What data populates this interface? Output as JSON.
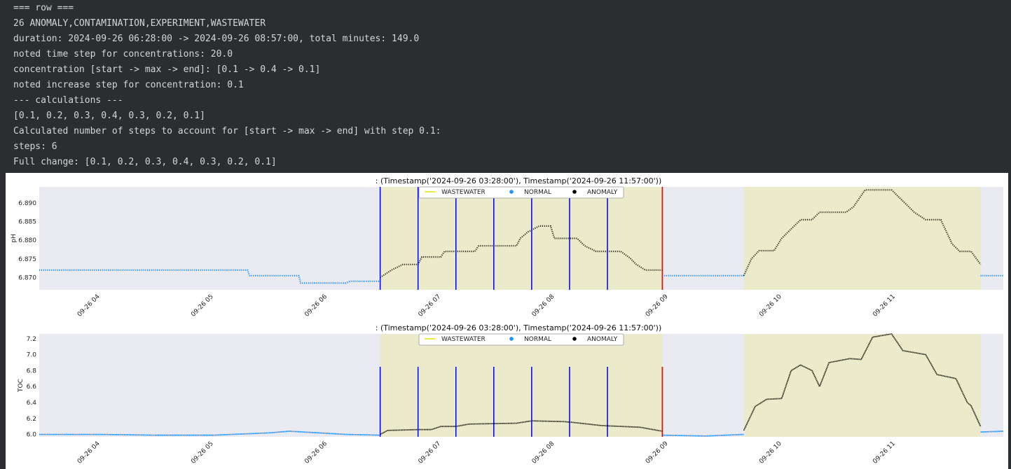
{
  "console": {
    "lines": [
      "=== row ===",
      "26 ANOMALY,CONTAMINATION,EXPERIMENT,WASTEWATER",
      "duration: 2024-09-26 06:28:00 -> 2024-09-26 08:57:00, total minutes: 149.0",
      "noted time step for concentrations: 20.0",
      "concentration [start -> max -> end]: [0.1 -> 0.4 -> 0.1]",
      "noted increase step for concentration: 0.1",
      "--- calculations ---",
      "[0.1, 0.2, 0.3, 0.4, 0.3, 0.2, 0.1]",
      "Calculated number of steps to account for [start -> max -> end] with step 0.1:",
      "steps: 6",
      "Full change: [0.1, 0.2, 0.3, 0.4, 0.3, 0.2, 0.1]"
    ]
  },
  "colors": {
    "background": "#2b2d30",
    "console_text": "#d4d6da",
    "plot_bg": "#eaeaf2",
    "wastewater_band": "#ebebcb",
    "normal": "#1e90ff",
    "anomaly": "#000000",
    "wastewater_legend": "#e6e600",
    "step_line": "#0000cc",
    "end_line": "#dd1111"
  },
  "chart_data": [
    {
      "type": "scatter",
      "title": ": (Timestamp('2024-09-26 03:28:00'), Timestamp('2024-09-26 11:57:00'))",
      "xlabel": "",
      "ylabel": "pH",
      "xlim": [
        "2024-09-26 03:28",
        "2024-09-26 11:57"
      ],
      "ylim": [
        6.8667,
        6.8943
      ],
      "x_ticks": [
        "09-26 04",
        "09-26 05",
        "09-26 06",
        "09-26 07",
        "09-26 08",
        "09-26 09",
        "09-26 10",
        "09-26 11"
      ],
      "y_ticks": [
        "6.870",
        "6.875",
        "6.880",
        "6.885",
        "6.890"
      ],
      "legend": [
        "WASTEWATER",
        "NORMAL",
        "ANOMALY"
      ],
      "legend_position": "top-center",
      "grid": false,
      "wastewater_spans": [
        [
          "2024-09-26 06:28",
          "2024-09-26 08:57"
        ],
        [
          "2024-09-26 09:40",
          "2024-09-26 11:45"
        ]
      ],
      "step_lines": [
        "2024-09-26 06:28",
        "2024-09-26 06:48",
        "2024-09-26 07:08",
        "2024-09-26 07:28",
        "2024-09-26 07:48",
        "2024-09-26 08:08",
        "2024-09-26 08:28"
      ],
      "end_line": "2024-09-26 08:57",
      "series": [
        {
          "name": "NORMAL",
          "points": [
            [
              "2024-09-26 03:28",
              6.872
            ],
            [
              "2024-09-26 04:00",
              6.872
            ],
            [
              "2024-09-26 04:30",
              6.872
            ],
            [
              "2024-09-26 05:00",
              6.872
            ],
            [
              "2024-09-26 05:18",
              6.872
            ],
            [
              "2024-09-26 05:19",
              6.8705
            ],
            [
              "2024-09-26 05:45",
              6.8705
            ],
            [
              "2024-09-26 05:46",
              6.8685
            ],
            [
              "2024-09-26 06:10",
              6.8685
            ],
            [
              "2024-09-26 06:12",
              6.869
            ],
            [
              "2024-09-26 06:28",
              6.869
            ]
          ]
        },
        {
          "name": "NORMAL",
          "points": [
            [
              "2024-09-26 08:58",
              6.8705
            ],
            [
              "2024-09-26 09:40",
              6.8705
            ]
          ]
        },
        {
          "name": "NORMAL",
          "points": [
            [
              "2024-09-26 11:45",
              6.8705
            ],
            [
              "2024-09-26 11:57",
              6.8705
            ]
          ]
        },
        {
          "name": "ANOMALY",
          "points": [
            [
              "2024-09-26 06:28",
              6.87
            ],
            [
              "2024-09-26 06:34",
              6.872
            ],
            [
              "2024-09-26 06:40",
              6.8735
            ],
            [
              "2024-09-26 06:48",
              6.8735
            ],
            [
              "2024-09-26 06:50",
              6.8755
            ],
            [
              "2024-09-26 07:00",
              6.8755
            ],
            [
              "2024-09-26 07:02",
              6.877
            ],
            [
              "2024-09-26 07:18",
              6.877
            ],
            [
              "2024-09-26 07:20",
              6.8785
            ],
            [
              "2024-09-26 07:28",
              6.8785
            ],
            [
              "2024-09-26 07:40",
              6.8785
            ],
            [
              "2024-09-26 07:42",
              6.8805
            ],
            [
              "2024-09-26 07:46",
              6.8822
            ],
            [
              "2024-09-26 07:52",
              6.8838
            ],
            [
              "2024-09-26 07:58",
              6.8838
            ],
            [
              "2024-09-26 08:00",
              6.8805
            ],
            [
              "2024-09-26 08:12",
              6.8805
            ],
            [
              "2024-09-26 08:16",
              6.8785
            ],
            [
              "2024-09-26 08:22",
              6.877
            ],
            [
              "2024-09-26 08:35",
              6.877
            ],
            [
              "2024-09-26 08:40",
              6.8752
            ],
            [
              "2024-09-26 08:43",
              6.8736
            ],
            [
              "2024-09-26 08:48",
              6.872
            ],
            [
              "2024-09-26 08:57",
              6.872
            ]
          ]
        },
        {
          "name": "ANOMALY",
          "points": [
            [
              "2024-09-26 09:40",
              6.8705
            ],
            [
              "2024-09-26 09:44",
              6.875
            ],
            [
              "2024-09-26 09:48",
              6.8772
            ],
            [
              "2024-09-26 09:56",
              6.8772
            ],
            [
              "2024-09-26 10:00",
              6.8805
            ],
            [
              "2024-09-26 10:06",
              6.8835
            ],
            [
              "2024-09-26 10:10",
              6.8855
            ],
            [
              "2024-09-26 10:16",
              6.8855
            ],
            [
              "2024-09-26 10:20",
              6.8875
            ],
            [
              "2024-09-26 10:34",
              6.8875
            ],
            [
              "2024-09-26 10:38",
              6.889
            ],
            [
              "2024-09-26 10:44",
              6.8935
            ],
            [
              "2024-09-26 10:58",
              6.8935
            ],
            [
              "2024-09-26 11:04",
              6.8905
            ],
            [
              "2024-09-26 11:10",
              6.8875
            ],
            [
              "2024-09-26 11:16",
              6.8855
            ],
            [
              "2024-09-26 11:24",
              6.8855
            ],
            [
              "2024-09-26 11:30",
              6.879
            ],
            [
              "2024-09-26 11:34",
              6.877
            ],
            [
              "2024-09-26 11:40",
              6.877
            ],
            [
              "2024-09-26 11:45",
              6.8735
            ]
          ]
        }
      ]
    },
    {
      "type": "scatter",
      "title": ": (Timestamp('2024-09-26 03:28:00'), Timestamp('2024-09-26 11:57:00'))",
      "xlabel": "",
      "ylabel": "TOC",
      "xlim": [
        "2024-09-26 03:28",
        "2024-09-26 11:57"
      ],
      "ylim": [
        5.97,
        7.26
      ],
      "x_ticks": [
        "09-26 04",
        "09-26 05",
        "09-26 06",
        "09-26 07",
        "09-26 08",
        "09-26 09",
        "09-26 10",
        "09-26 11"
      ],
      "y_ticks": [
        "6.0",
        "6.2",
        "6.4",
        "6.6",
        "6.8",
        "7.0",
        "7.2"
      ],
      "legend": [
        "WASTEWATER",
        "NORMAL",
        "ANOMALY"
      ],
      "legend_position": "top-center",
      "grid": false,
      "wastewater_spans": [
        [
          "2024-09-26 06:28",
          "2024-09-26 08:57"
        ],
        [
          "2024-09-26 09:40",
          "2024-09-26 11:45"
        ]
      ],
      "step_lines": [
        "2024-09-26 06:28",
        "2024-09-26 06:48",
        "2024-09-26 07:08",
        "2024-09-26 07:28",
        "2024-09-26 07:48",
        "2024-09-26 08:08",
        "2024-09-26 08:28"
      ],
      "end_line": "2024-09-26 08:57",
      "series": [
        {
          "name": "NORMAL",
          "points": [
            [
              "2024-09-26 03:28",
              6.0
            ],
            [
              "2024-09-26 04:00",
              6.0
            ],
            [
              "2024-09-26 04:30",
              5.99
            ],
            [
              "2024-09-26 05:00",
              5.99
            ],
            [
              "2024-09-26 05:30",
              6.02
            ],
            [
              "2024-09-26 05:40",
              6.04
            ],
            [
              "2024-09-26 05:55",
              6.02
            ],
            [
              "2024-09-26 06:10",
              6.0
            ],
            [
              "2024-09-26 06:28",
              5.99
            ]
          ]
        },
        {
          "name": "NORMAL",
          "points": [
            [
              "2024-09-26 08:57",
              5.99
            ],
            [
              "2024-09-26 09:20",
              5.98
            ],
            [
              "2024-09-26 09:40",
              6.0
            ]
          ]
        },
        {
          "name": "NORMAL",
          "points": [
            [
              "2024-09-26 11:45",
              6.03
            ],
            [
              "2024-09-26 11:57",
              6.04
            ]
          ]
        },
        {
          "name": "ANOMALY",
          "points": [
            [
              "2024-09-26 06:28",
              6.0
            ],
            [
              "2024-09-26 06:32",
              6.05
            ],
            [
              "2024-09-26 06:48",
              6.06
            ],
            [
              "2024-09-26 06:55",
              6.06
            ],
            [
              "2024-09-26 07:00",
              6.1
            ],
            [
              "2024-09-26 07:08",
              6.1
            ],
            [
              "2024-09-26 07:15",
              6.13
            ],
            [
              "2024-09-26 07:40",
              6.14
            ],
            [
              "2024-09-26 07:48",
              6.17
            ],
            [
              "2024-09-26 08:05",
              6.16
            ],
            [
              "2024-09-26 08:10",
              6.15
            ],
            [
              "2024-09-26 08:25",
              6.11
            ],
            [
              "2024-09-26 08:45",
              6.09
            ],
            [
              "2024-09-26 08:57",
              6.04
            ]
          ]
        },
        {
          "name": "ANOMALY",
          "points": [
            [
              "2024-09-26 09:40",
              6.05
            ],
            [
              "2024-09-26 09:46",
              6.35
            ],
            [
              "2024-09-26 09:52",
              6.44
            ],
            [
              "2024-09-26 10:00",
              6.45
            ],
            [
              "2024-09-26 10:05",
              6.8
            ],
            [
              "2024-09-26 10:10",
              6.87
            ],
            [
              "2024-09-26 10:16",
              6.8
            ],
            [
              "2024-09-26 10:20",
              6.6
            ],
            [
              "2024-09-26 10:25",
              6.9
            ],
            [
              "2024-09-26 10:36",
              6.95
            ],
            [
              "2024-09-26 10:42",
              6.94
            ],
            [
              "2024-09-26 10:48",
              7.22
            ],
            [
              "2024-09-26 10:58",
              7.26
            ],
            [
              "2024-09-26 11:04",
              7.05
            ],
            [
              "2024-09-26 11:16",
              7.0
            ],
            [
              "2024-09-26 11:22",
              6.75
            ],
            [
              "2024-09-26 11:32",
              6.7
            ],
            [
              "2024-09-26 11:38",
              6.4
            ],
            [
              "2024-09-26 11:40",
              6.36
            ],
            [
              "2024-09-26 11:45",
              6.1
            ]
          ]
        }
      ]
    }
  ]
}
